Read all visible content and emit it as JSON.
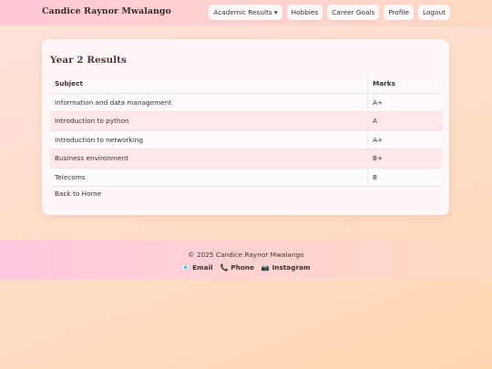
{
  "nav": {
    "brand": "Candice Raynor Mwalango",
    "items": [
      "Academic Results ▾",
      "Hobbies",
      "Career Goals",
      "Profile",
      "Logout"
    ]
  },
  "results": {
    "title": "Year 2 Results",
    "headers": {
      "subject": "Subject",
      "marks": "Marks"
    },
    "rows": [
      {
        "subject": "Information and data management",
        "mark": "A+"
      },
      {
        "subject": "Introduction to python",
        "mark": "A"
      },
      {
        "subject": "Introduction to networking",
        "mark": "A+"
      },
      {
        "subject": "Business environment",
        "mark": "B+"
      },
      {
        "subject": "Telecoms",
        "mark": "B"
      }
    ],
    "back_link": "Back to Home"
  },
  "footer": {
    "copyright": "© 2025 Candice Raynor Mwalango",
    "links": [
      {
        "icon": "📧",
        "label": "Email"
      },
      {
        "icon": "📞",
        "label": "Phone"
      },
      {
        "icon": "📷",
        "label": "Instagram"
      }
    ]
  }
}
